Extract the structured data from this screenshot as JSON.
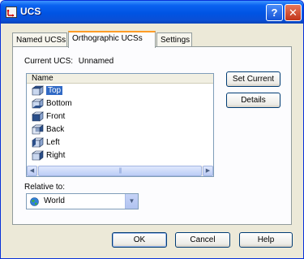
{
  "window": {
    "title": "UCS"
  },
  "titlebar_buttons": {
    "help": "?",
    "close": "✕"
  },
  "tabs": [
    {
      "label": "Named UCSs"
    },
    {
      "label": "Orthographic UCSs"
    },
    {
      "label": "Settings"
    }
  ],
  "current_ucs": {
    "label": "Current UCS:",
    "value": "Unnamed"
  },
  "list": {
    "header": "Name",
    "items": [
      {
        "label": "Top",
        "icon": "cube-top-icon",
        "selected": true
      },
      {
        "label": "Bottom",
        "icon": "cube-bottom-icon",
        "selected": false
      },
      {
        "label": "Front",
        "icon": "cube-front-icon",
        "selected": false
      },
      {
        "label": "Back",
        "icon": "cube-back-icon",
        "selected": false
      },
      {
        "label": "Left",
        "icon": "cube-left-icon",
        "selected": false
      },
      {
        "label": "Right",
        "icon": "cube-right-icon",
        "selected": false
      }
    ]
  },
  "side_buttons": {
    "set_current": "Set Current",
    "details": "Details"
  },
  "relative_to": {
    "label": "Relative to:",
    "value": "World"
  },
  "footer_buttons": {
    "ok": "OK",
    "cancel": "Cancel",
    "help": "Help"
  },
  "colors": {
    "title_bar": "#0054e3",
    "selection": "#316ac5",
    "tab_highlight": "#ff9c26",
    "dialog_bg": "#ece9d8"
  }
}
